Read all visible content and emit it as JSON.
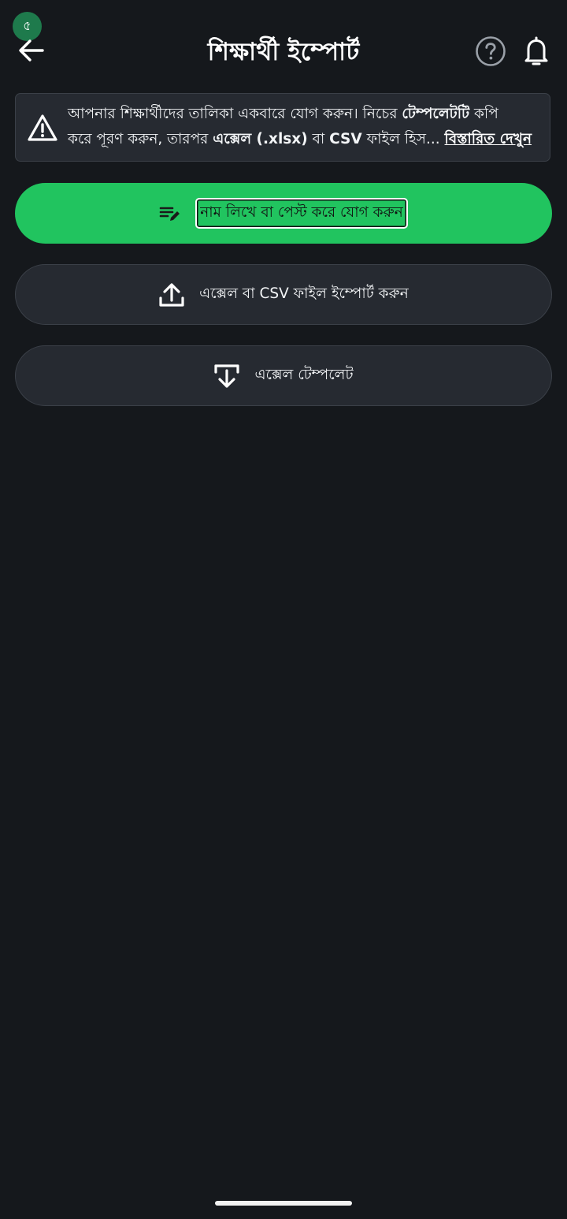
{
  "status_badge": {
    "glyph": "৫"
  },
  "header": {
    "title": "শিক্ষার্থী ইম্পোর্ট",
    "back_icon": "arrow-left-icon",
    "help_icon": "question-circle-icon",
    "bell_icon": "bell-icon"
  },
  "info_banner": {
    "icon": "warning-triangle-icon",
    "line1_a": "আপনার শিক্ষার্থীদের তালিকা একবারে যোগ করুন। নিচের ",
    "line1_b": "টেম্পলেটটি",
    "line1_c": " কপি",
    "line2_a": "করে পূরণ করুন, তারপর ",
    "line2_b": "এক্সেল (.xlsx)",
    "line2_c": " বা ",
    "line2_d": "CSV",
    "line2_e": " ফাইল হিস...",
    "link": "বিস্তারিত দেখুন"
  },
  "actions": {
    "paste": {
      "label": "নাম লিখে বা পেস্ট করে যোগ করুন",
      "icon": "edit-list-icon"
    },
    "import": {
      "label": "এক্সেল বা CSV ফাইল ইম্পোর্ট করুন",
      "icon": "upload-icon"
    },
    "template": {
      "label": "এক্সেল টেম্পলেট",
      "icon": "download-icon"
    }
  },
  "colors": {
    "background": "#15181c",
    "card": "#262a31",
    "accent_green": "#21c45f",
    "badge_green": "#1e7a4c"
  }
}
